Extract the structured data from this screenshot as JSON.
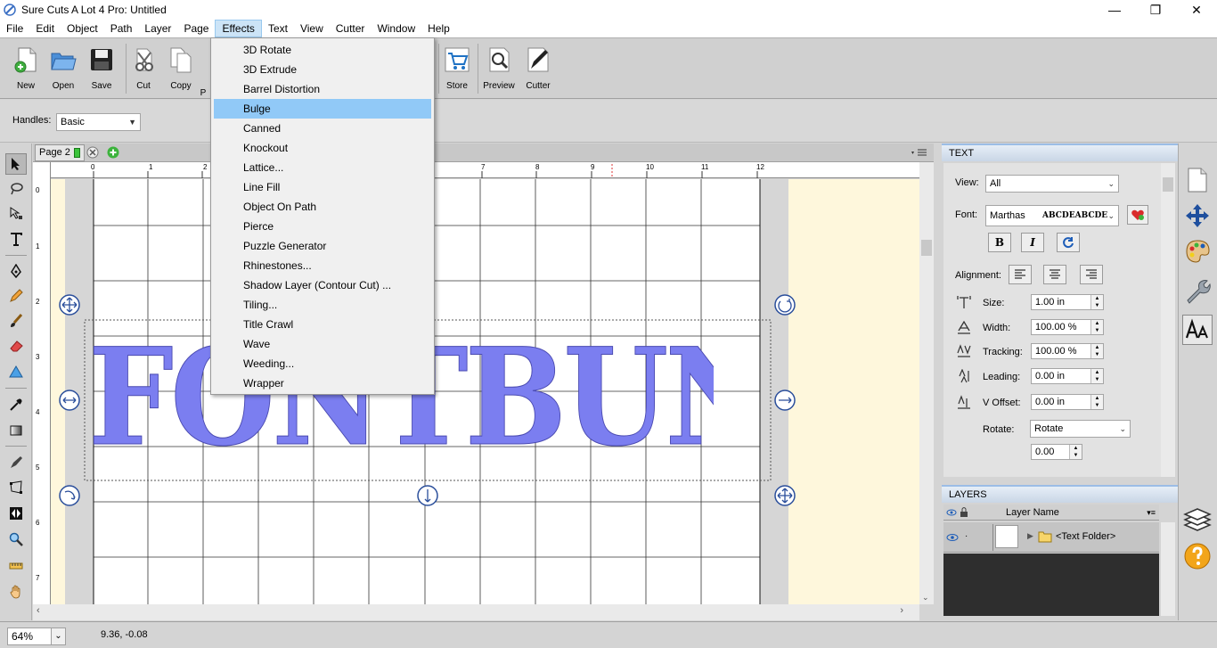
{
  "window": {
    "title": "Sure Cuts A Lot 4 Pro: Untitled",
    "minimize": "—",
    "maximize": "❐",
    "close": "✕"
  },
  "menubar": {
    "items": [
      "File",
      "Edit",
      "Object",
      "Path",
      "Layer",
      "Page",
      "Effects",
      "Text",
      "View",
      "Cutter",
      "Window",
      "Help"
    ],
    "active": "Effects"
  },
  "toolbar": {
    "new": "New",
    "open": "Open",
    "save": "Save",
    "cut": "Cut",
    "copy": "Copy",
    "paste_partial": "P",
    "store": "Store",
    "preview": "Preview",
    "cutter": "Cutter"
  },
  "options": {
    "handles_label": "Handles:",
    "handles_value": "Basic"
  },
  "effects_menu": {
    "items": [
      "3D Rotate",
      "3D Extrude",
      "Barrel Distortion",
      "Bulge",
      "Canned",
      "Knockout",
      "Lattice...",
      "Line Fill",
      "Object On Path",
      "Pierce",
      "Puzzle Generator",
      "Rhinestones...",
      "Shadow Layer (Contour Cut) ...",
      "Tiling...",
      "Title Crawl",
      "Wave",
      "Weeding...",
      "Wrapper"
    ],
    "highlighted": "Bulge"
  },
  "page_tab": {
    "label": "Page 2"
  },
  "ruler": {
    "h_ticks": [
      "0",
      "1",
      "2",
      "7",
      "8",
      "9",
      "10",
      "11",
      "12"
    ],
    "v_ticks": [
      "0",
      "1",
      "2",
      "3",
      "4",
      "5",
      "6",
      "7"
    ]
  },
  "canvas": {
    "design_text": "FONTBUNDLES",
    "design_color": "#7b7ef0"
  },
  "text_panel": {
    "title": "TEXT",
    "view_label": "View:",
    "view_value": "All",
    "font_label": "Font:",
    "font_value": "Marthas",
    "font_preview": "ABCDEABCDE",
    "bold": "B",
    "italic": "I",
    "alignment_label": "Alignment:",
    "size_label": "Size:",
    "size_value": "1.00 in",
    "width_label": "Width:",
    "width_value": "100.00 %",
    "tracking_label": "Tracking:",
    "tracking_value": "100.00 %",
    "leading_label": "Leading:",
    "leading_value": "0.00 in",
    "voffset_label": "V Offset:",
    "voffset_value": "0.00 in",
    "rotate_label": "Rotate:",
    "rotate_value": "Rotate",
    "rotate_amount": "0.00"
  },
  "layers_panel": {
    "title": "LAYERS",
    "column": "Layer Name",
    "row_label": "<Text Folder>"
  },
  "statusbar": {
    "zoom": "64%",
    "coords": "9.36, -0.08"
  },
  "colors": {
    "menu_highlight": "#91c9f7",
    "canvas_bg": "#fef7dc",
    "panel_accent": "#9bbde6"
  }
}
